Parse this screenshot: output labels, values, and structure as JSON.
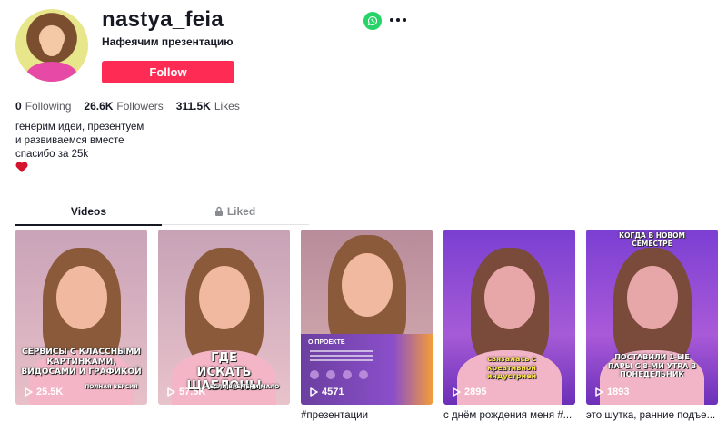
{
  "profile": {
    "username": "nastya_feia",
    "subtitle": "Нафеячим презентацию",
    "follow_label": "Follow",
    "stats": [
      {
        "value": "0",
        "label": "Following"
      },
      {
        "value": "26.6K",
        "label": "Followers"
      },
      {
        "value": "311.5K",
        "label": "Likes"
      }
    ],
    "bio": [
      "генерим идеи, презентуем",
      "и развиваемся вместе",
      "спасибо за 25k"
    ],
    "share_icon": "whatsapp-icon",
    "more_icon": "more-icon"
  },
  "tabs": {
    "videos": "Videos",
    "liked": "Liked"
  },
  "colors": {
    "accent": "#fe2c55",
    "whatsapp": "#25d366"
  },
  "videos": [
    {
      "views": "25.5K",
      "overlay": "СЕРВИСЫ С КЛАССНЫМИ КАРТИНКАМИ, ВИДОСАМИ И ГРАФИКОЙ",
      "overlay_sub": "ПОЛНАЯ ВЕРСИЯ",
      "caption": ""
    },
    {
      "views": "57.5K",
      "overlay": "ГДЕ ИСКАТЬ ШАБЛОНЫ",
      "overlay_sub": "ЕСЛИ ВРЕМЕНИ МАЛО",
      "caption": ""
    },
    {
      "views": "4571",
      "overlay": "О ПРОЕКТЕ",
      "overlay_sub": "",
      "caption": "#презентации"
    },
    {
      "views": "2895",
      "overlay": "связалась с креативной индустрией",
      "overlay_sub": "",
      "caption": "с днём рождения меня #..."
    },
    {
      "views": "1893",
      "overlay_top": "КОГДА В НОВОМ СЕМЕСТРЕ",
      "overlay": "ПОСТАВИЛИ 1-ЫЕ ПАРЫ С 8-МИ УТРА В ПОНЕДЕЛЬНИК",
      "overlay_sub": "",
      "caption": "это шутка, ранние подъе..."
    }
  ]
}
